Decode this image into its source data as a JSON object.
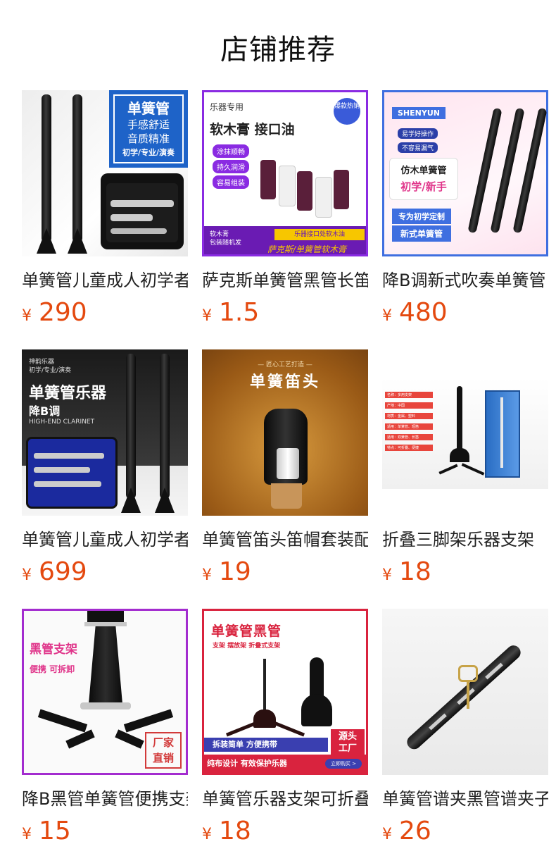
{
  "header": {
    "title": "店铺推荐"
  },
  "currency_symbol": "¥",
  "products": [
    {
      "name": "单簧管儿童成人初学者",
      "price": "290",
      "thumb": {
        "lines": [
          "单簧管",
          "手感舒适",
          "音质精准",
          "初学/专业/演奏"
        ]
      }
    },
    {
      "name": "萨克斯单簧管黑管长笛",
      "price": "1.5",
      "thumb": {
        "top": "乐器专用",
        "headline": "软木膏 接口油",
        "badge": "爆款热销",
        "tags": [
          "涂抹顺畅",
          "持久润滑",
          "容易组装"
        ],
        "footer_left": "软木膏\n包装随机发",
        "footer_right": "萨克斯/单簧管软木膏",
        "footer_strip": "乐器接口处软木油"
      }
    },
    {
      "name": "降B调新式吹奏单簧管",
      "price": "480",
      "thumb": {
        "brand": "SHENYUN",
        "pills": [
          "易学好操作",
          "不容易漏气"
        ],
        "box_title": "仿木单簧管",
        "box_sub": "初学/新手",
        "bottom": [
          "专为初学定制",
          "新式单簧管"
        ]
      }
    },
    {
      "name": "单簧管儿童成人初学者",
      "price": "699",
      "thumb": {
        "small": "神韵乐器\n初学/专业/演奏",
        "headline": "单簧管乐器",
        "sub": "降B调",
        "eng": "HIGH-END CLARINET"
      }
    },
    {
      "name": "单簧管笛头笛帽套装配件",
      "price": "19",
      "thumb": {
        "top": "— 匠心工艺打造 —",
        "headline": "单簧笛头"
      }
    },
    {
      "name": "折叠三脚架乐器支架",
      "price": "18",
      "thumb": {
        "specs": [
          "名称：多用支架",
          "产地：中国",
          "材质：金属、塑料",
          "适用：单簧管、短笛",
          "适用：双簧管、长笛",
          "特点：可折叠、便捷"
        ]
      }
    },
    {
      "name": "降B黑管单簧管便携支架",
      "price": "15",
      "thumb": {
        "title": "黑管支架",
        "sub": "便携 可拆卸",
        "stamp": [
          "厂家",
          "直销"
        ]
      }
    },
    {
      "name": "单簧管乐器支架可折叠",
      "price": "18",
      "thumb": {
        "title": "单簧管黑管",
        "sub": "支架 摆放架 折叠式支架",
        "corner": [
          "源头",
          "工厂"
        ],
        "banner1": "拆装简单 方便携带",
        "banner2": "纯布设计 有效保护乐器",
        "buy": "立即购买 >"
      }
    },
    {
      "name": "单簧管谱夹黑管谱夹子",
      "price": "26",
      "thumb": {}
    }
  ],
  "colors": {
    "price": "#e4490f",
    "title": "#111111",
    "name": "#222222"
  }
}
